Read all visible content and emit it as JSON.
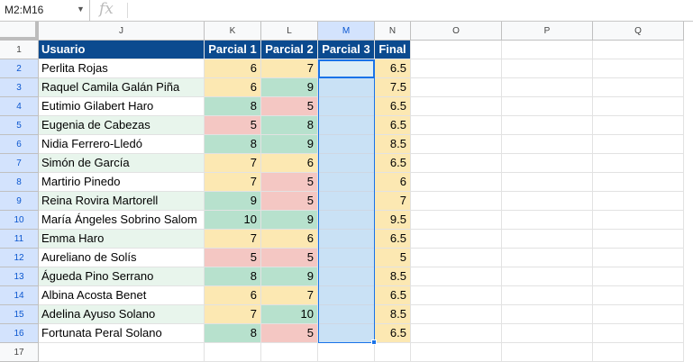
{
  "formula_bar": {
    "name_box": "M2:M16",
    "fx_icon": "fx-icon",
    "formula": ""
  },
  "columns": [
    "J",
    "K",
    "L",
    "M",
    "N",
    "O",
    "P",
    "Q"
  ],
  "selected_column": "M",
  "header": [
    "Usuario",
    "Parcial 1",
    "Parcial 2",
    "Parcial 3",
    "Final"
  ],
  "rows": [
    {
      "name": "Perlita Rojas",
      "p1": "6",
      "p2": "7",
      "final": "6.5"
    },
    {
      "name": "Raquel Camila Galán Piña",
      "p1": "6",
      "p2": "9",
      "final": "7.5"
    },
    {
      "name": "Eutimio Gilabert Haro",
      "p1": "8",
      "p2": "5",
      "final": "6.5"
    },
    {
      "name": "Eugenia de Cabezas",
      "p1": "5",
      "p2": "8",
      "final": "6.5"
    },
    {
      "name": "Nidia Ferrero-Lledó",
      "p1": "8",
      "p2": "9",
      "final": "8.5"
    },
    {
      "name": "Simón de García",
      "p1": "7",
      "p2": "6",
      "final": "6.5"
    },
    {
      "name": "Martirio Pinedo",
      "p1": "7",
      "p2": "5",
      "final": "6"
    },
    {
      "name": "Reina Rovira Martorell",
      "p1": "9",
      "p2": "5",
      "final": "7"
    },
    {
      "name": "María Ángeles Sobrino Salom",
      "p1": "10",
      "p2": "9",
      "final": "9.5"
    },
    {
      "name": "Emma Haro",
      "p1": "7",
      "p2": "6",
      "final": "6.5"
    },
    {
      "name": "Aureliano de Solís",
      "p1": "5",
      "p2": "5",
      "final": "5"
    },
    {
      "name": "Águeda Pino Serrano",
      "p1": "8",
      "p2": "9",
      "final": "8.5"
    },
    {
      "name": "Albina Acosta Benet",
      "p1": "6",
      "p2": "7",
      "final": "6.5"
    },
    {
      "name": "Adelina Ayuso Solano",
      "p1": "7",
      "p2": "10",
      "final": "8.5"
    },
    {
      "name": "Fortunata Peral Solano",
      "p1": "8",
      "p2": "5",
      "final": "6.5"
    }
  ],
  "colors": {
    "header_bg": "#0b4a8f",
    "name_band_alt": "#e8f5ec",
    "grade_low": "#f4c7c3",
    "grade_mid": "#fce8b2",
    "grade_high": "#b7e1cd",
    "empty_col": "#ddeef6",
    "final_bg": "#fce8b2",
    "selection": "#1a73e8"
  }
}
